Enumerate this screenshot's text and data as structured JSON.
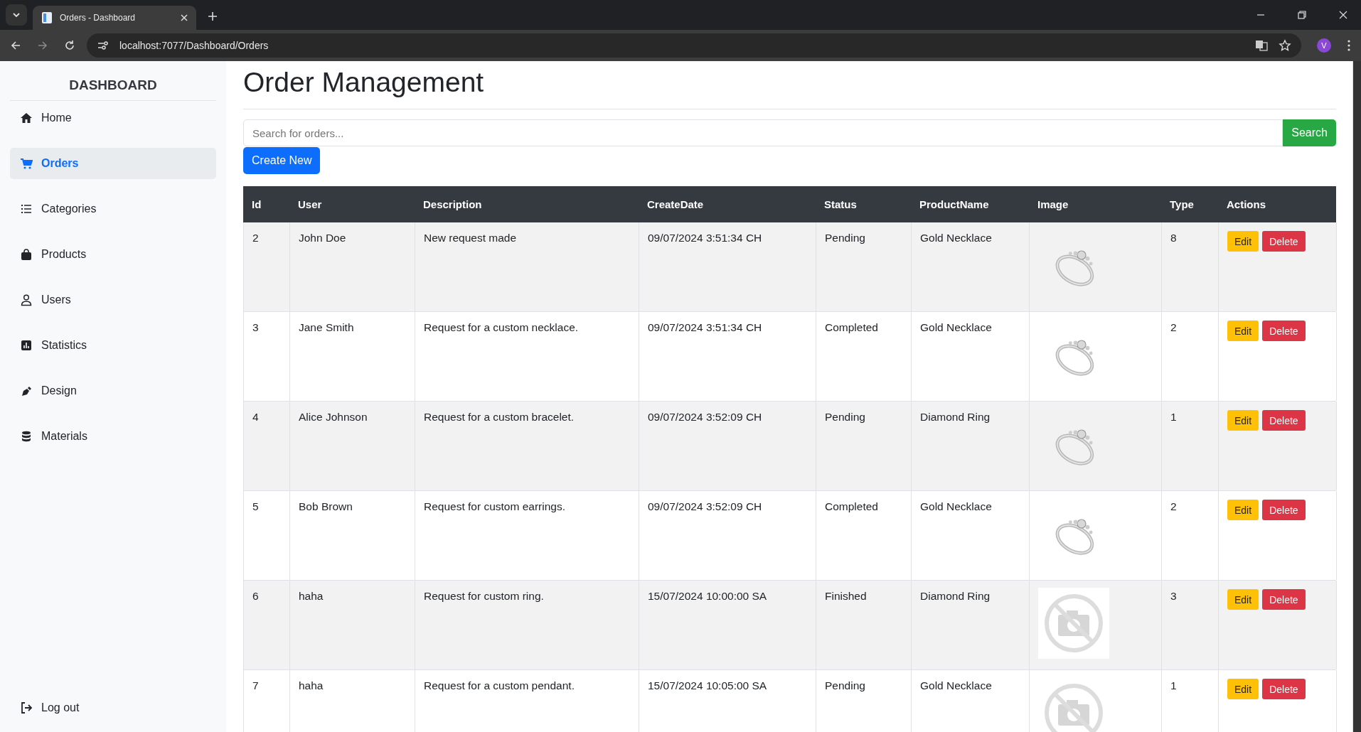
{
  "browser": {
    "tab_title": "Orders - Dashboard",
    "url": "localhost:7077/Dashboard/Orders",
    "profile_initial": "V"
  },
  "sidebar": {
    "title": "DASHBOARD",
    "items": [
      {
        "label": "Home",
        "kind": "home",
        "selected": false
      },
      {
        "label": "Orders",
        "kind": "cart",
        "selected": true
      },
      {
        "label": "Categories",
        "kind": "list",
        "selected": false
      },
      {
        "label": "Products",
        "kind": "bag",
        "selected": false
      },
      {
        "label": "Users",
        "kind": "user",
        "selected": false
      },
      {
        "label": "Statistics",
        "kind": "chart",
        "selected": false
      },
      {
        "label": "Design",
        "kind": "pen",
        "selected": false
      },
      {
        "label": "Materials",
        "kind": "database",
        "selected": false
      }
    ],
    "logout": "Log out"
  },
  "page": {
    "title": "Order Management",
    "search": {
      "placeholder": "Search for orders..."
    },
    "search_button": "Search",
    "create_button": "Create New"
  },
  "table": {
    "columns": [
      "Id",
      "User",
      "Description",
      "CreateDate",
      "Status",
      "ProductName",
      "Image",
      "Type",
      "Actions"
    ],
    "rows": [
      {
        "id": "2",
        "user": "John Doe",
        "description": "New request made",
        "create_date": "09/07/2024 3:51:34 CH",
        "status": "Pending",
        "product": "Gold Necklace",
        "type": "8",
        "edit": "Edit",
        "delete": "Delete"
      },
      {
        "id": "3",
        "user": "Jane Smith",
        "description": "Request for a custom necklace.",
        "create_date": "09/07/2024 3:51:34 CH",
        "status": "Completed",
        "product": "Gold Necklace",
        "type": "2",
        "edit": "Edit",
        "delete": "Delete"
      },
      {
        "id": "4",
        "user": "Alice Johnson",
        "description": "Request for a custom bracelet.",
        "create_date": "09/07/2024 3:52:09 CH",
        "status": "Pending",
        "product": "Diamond Ring",
        "type": "1",
        "edit": "Edit",
        "delete": "Delete"
      },
      {
        "id": "5",
        "user": "Bob Brown",
        "description": "Request for custom earrings.",
        "create_date": "09/07/2024 3:52:09 CH",
        "status": "Completed",
        "product": "Gold Necklace",
        "type": "2",
        "edit": "Edit",
        "delete": "Delete"
      },
      {
        "id": "6",
        "user": "haha",
        "description": "Request for custom ring.",
        "create_date": "15/07/2024 10:00:00 SA",
        "status": "Finished",
        "product": "Diamond Ring",
        "image": {
          "kind": "placeholder"
        },
        "type": "3",
        "edit": "Edit",
        "delete": "Delete"
      },
      {
        "id": "7",
        "user": "haha",
        "description": "Request for a custom pendant.",
        "create_date": "15/07/2024 10:05:00 SA",
        "status": "Pending",
        "product": "Gold Necklace",
        "image": {
          "kind": "placeholder"
        },
        "type": "1",
        "edit": "Edit",
        "delete": "Delete"
      }
    ]
  }
}
